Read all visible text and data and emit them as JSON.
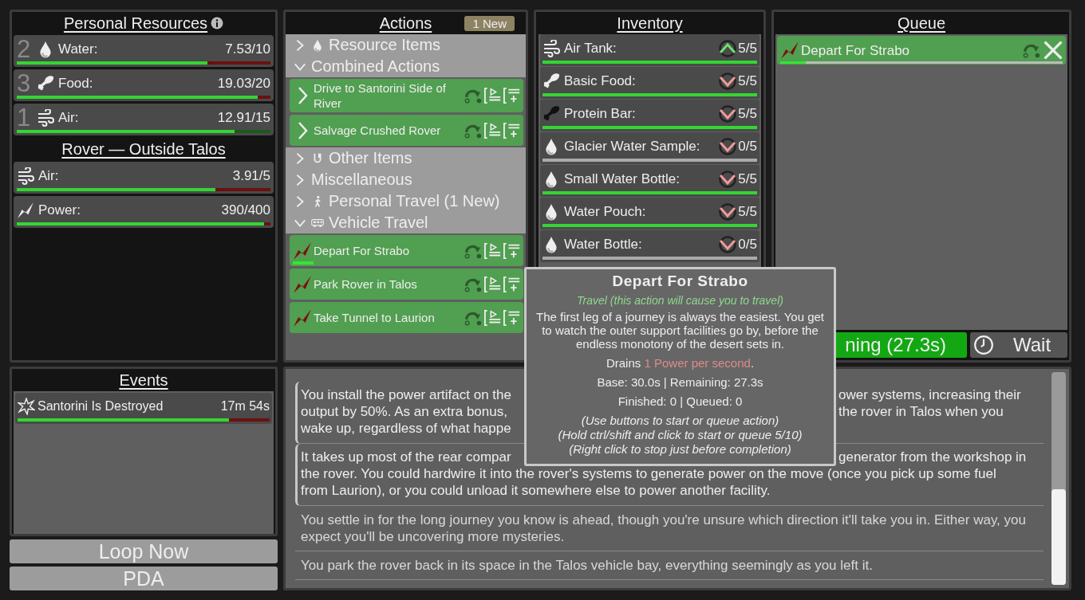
{
  "resources": {
    "title": "Personal Resources",
    "items": [
      {
        "kind": "water",
        "count": "2",
        "label": "Water:",
        "value": "7.53/10",
        "level": 0.753,
        "warning": true
      },
      {
        "kind": "food",
        "count": "3",
        "label": "Food:",
        "value": "19.03/20",
        "level": 0.951,
        "warning": true
      },
      {
        "kind": "air",
        "count": "1",
        "label": "Air:",
        "value": "12.91/15",
        "level": 0.86,
        "warning": false
      }
    ]
  },
  "rover": {
    "title": "Rover — Outside Talos",
    "items": [
      {
        "kind": "air",
        "label": "Air:",
        "value": "3.91/5",
        "level": 0.782,
        "warning": true
      },
      {
        "kind": "power",
        "label": "Power:",
        "value": "390/400",
        "level": 0.975,
        "warning": true
      }
    ]
  },
  "actions": {
    "title": "Actions",
    "badge": "1 New",
    "groups": [
      {
        "kind": "resource",
        "label": "Resource Items",
        "expanded": false
      },
      {
        "kind": "combined",
        "label": "Combined Actions",
        "expanded": true,
        "actions": [
          {
            "kind": "combined",
            "label": "Drive to Santorini Side of River"
          },
          {
            "kind": "combined",
            "label": "Salvage Crushed Rover"
          }
        ]
      },
      {
        "kind": "other",
        "label": "Other Items",
        "expanded": false
      },
      {
        "kind": "misc",
        "label": "Miscellaneous",
        "expanded": false
      },
      {
        "kind": "personal_travel",
        "label": "Personal Travel (1 New)",
        "expanded": false
      },
      {
        "kind": "vehicle_travel",
        "label": "Vehicle Travel",
        "expanded": true,
        "actions": [
          {
            "kind": "travel",
            "label": "Depart For Strabo",
            "level": 0.09
          },
          {
            "kind": "travel",
            "label": "Park Rover in Talos"
          },
          {
            "kind": "travel",
            "label": "Take Tunnel to Laurion"
          }
        ]
      }
    ]
  },
  "inventory": {
    "title": "Inventory",
    "items": [
      {
        "kind": "air",
        "label": "Air Tank:",
        "count": "5/5",
        "stocked": true,
        "raised": true
      },
      {
        "kind": "food",
        "label": "Basic Food:",
        "count": "5/5",
        "stocked": true,
        "raised": false
      },
      {
        "kind": "protein",
        "label": "Protein Bar:",
        "count": "5/5",
        "stocked": true,
        "raised": false
      },
      {
        "kind": "water",
        "label": "Glacier Water Sample:",
        "count": "0/5",
        "stocked": false,
        "raised": false
      },
      {
        "kind": "water",
        "label": "Small Water Bottle:",
        "count": "5/5",
        "stocked": true,
        "raised": false
      },
      {
        "kind": "water",
        "label": "Water Pouch:",
        "count": "5/5",
        "stocked": true,
        "raised": false
      },
      {
        "kind": "water",
        "label": "Water Bottle:",
        "count": "0/5",
        "stocked": false,
        "raised": false
      }
    ]
  },
  "queue": {
    "title": "Queue",
    "items": [
      {
        "kind": "travel",
        "label": "Depart For Strabo",
        "level": 0.09
      }
    ],
    "running": "ning (27.3s)",
    "wait": "Wait"
  },
  "events": {
    "title": "Events",
    "items": [
      {
        "label": "Santorini Is Destroyed",
        "time": "17m 54s",
        "level": 0.84
      }
    ]
  },
  "buttons": [
    "Loop Now",
    "PDA"
  ],
  "log": [
    {
      "bracket": true,
      "covered_lines": [
        {
          "left": "You install the power artifact on the",
          "right": "ower systems, increasing their"
        },
        {
          "left": "output by 50%. As an extra bonus,",
          "right": "the rover in Talos when you"
        },
        {
          "left": "wake up, regardless of what happe"
        }
      ]
    },
    {
      "bracket": true,
      "covered_lines": [
        {
          "left": "It takes up most of the rear compar",
          "right": "generator from the workshop in"
        }
      ],
      "lines": [
        "the rover. You could hardwire it into the rover's systems to generate power on the move (once you pick up some fuel",
        "from Laurion), or you could unload it somewhere else to power another facility."
      ]
    },
    {
      "bracket": false,
      "text": "You settle in for the long journey you know is ahead, though you're unsure which direction it'll take you in. Either way, you expect you'll be uncovering more mysteries."
    },
    {
      "bracket": false,
      "text": "You park the rover back in its space in the Talos vehicle bay, everything seemingly as you left it."
    }
  ],
  "tooltip": {
    "title": "Depart For Strabo",
    "subtitle": "Travel (this action will cause you to travel)",
    "description": "The first leg of a journey is always the easiest. You get to watch the outer support facilities go by, before the endless monotony of the desert sets in.",
    "drains": [
      {
        "kind": "plain",
        "text": "Drains "
      },
      {
        "kind": "cost",
        "text": "1 Power per second"
      },
      {
        "kind": "plain",
        "text": "."
      }
    ],
    "stats": [
      "Base: 30.0s | Remaining: 27.3s",
      "Finished: 0 | Queued: 0"
    ],
    "hints": [
      "(Use buttons to start or queue action)",
      "(Hold ctrl/shift and click to start or queue 5/10)",
      "(Right click to stop just before completion)"
    ]
  }
}
